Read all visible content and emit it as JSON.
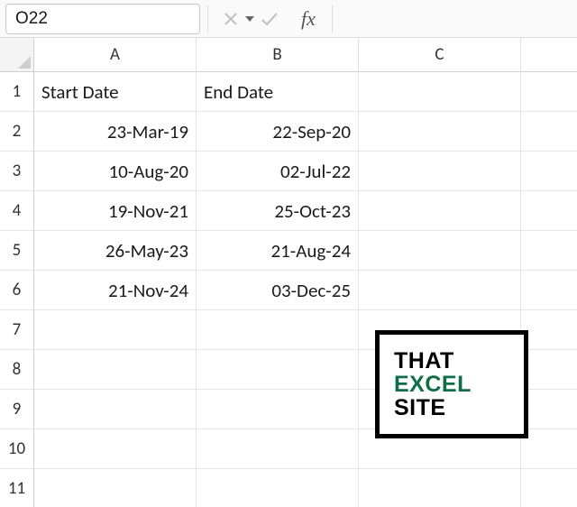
{
  "formula_bar": {
    "name_box_value": "O22",
    "cancel_tooltip": "Cancel",
    "enter_tooltip": "Enter",
    "fx_label": "fx",
    "formula_value": ""
  },
  "columns": [
    "A",
    "B",
    "C"
  ],
  "row_numbers": [
    "1",
    "2",
    "3",
    "4",
    "5",
    "6",
    "7",
    "8",
    "9",
    "10",
    "11"
  ],
  "chart_data": {
    "type": "table",
    "headers": {
      "A": "Start Date",
      "B": "End Date"
    },
    "rows": [
      {
        "A": "23-Mar-19",
        "B": "22-Sep-20"
      },
      {
        "A": "10-Aug-20",
        "B": "02-Jul-22"
      },
      {
        "A": "19-Nov-21",
        "B": "25-Oct-23"
      },
      {
        "A": "26-May-23",
        "B": "21-Aug-24"
      },
      {
        "A": "21-Nov-24",
        "B": "03-Dec-25"
      }
    ]
  },
  "watermark": {
    "line1": "THAT",
    "line2": "EXCEL",
    "line3": "SITE"
  }
}
